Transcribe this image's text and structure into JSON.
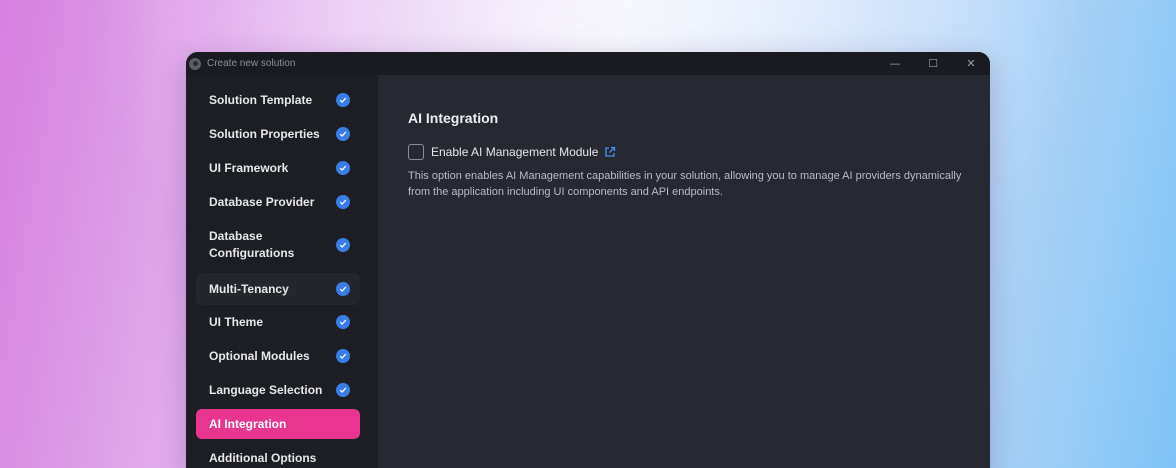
{
  "window": {
    "title": "Create new solution",
    "controls": {
      "minimize": "—",
      "maximize": "☐",
      "close": "✕"
    }
  },
  "sidebar": {
    "items": [
      {
        "label": "Solution Template",
        "completed": true
      },
      {
        "label": "Solution Properties",
        "completed": true
      },
      {
        "label": "UI Framework",
        "completed": true
      },
      {
        "label": "Database Provider",
        "completed": true
      },
      {
        "label": "Database Configurations",
        "completed": true
      },
      {
        "label": "Multi-Tenancy",
        "completed": true
      },
      {
        "label": "UI Theme",
        "completed": true
      },
      {
        "label": "Optional Modules",
        "completed": true
      },
      {
        "label": "Language Selection",
        "completed": true
      },
      {
        "label": "AI Integration",
        "completed": false,
        "active": true
      },
      {
        "label": "Additional Options",
        "completed": false
      }
    ]
  },
  "main": {
    "title": "AI Integration",
    "option": {
      "label": "Enable AI Management Module",
      "checked": false,
      "icon": "external-link-icon"
    },
    "description": "This option enables AI Management capabilities in your solution, allowing you to manage AI providers dynamically from the application including UI components and API endpoints."
  },
  "colors": {
    "accent": "#e8358f",
    "check": "#3a7de8",
    "link": "#4a90f0"
  }
}
